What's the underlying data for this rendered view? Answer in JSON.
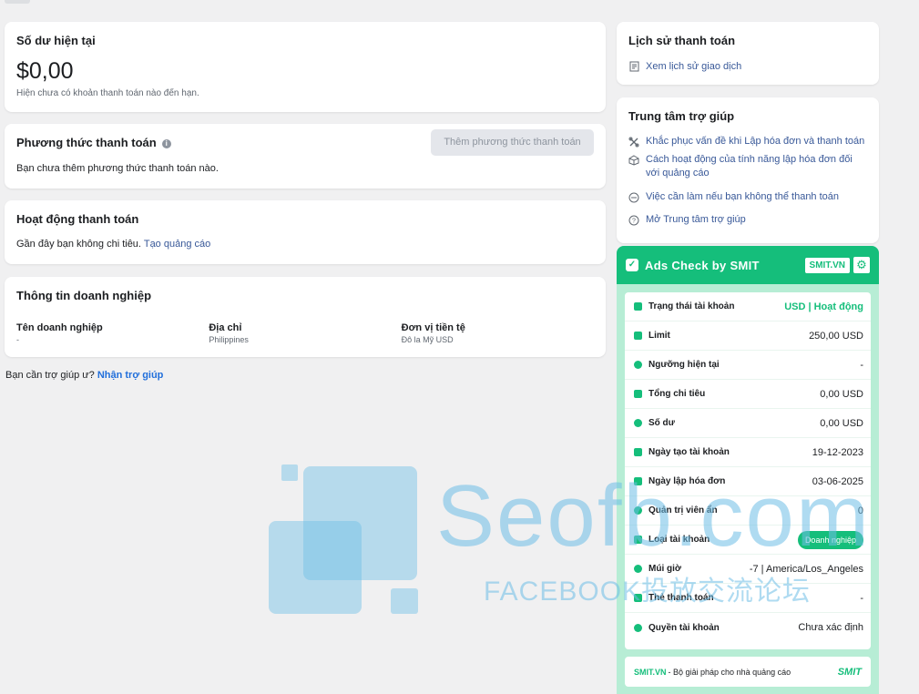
{
  "balance": {
    "title": "Số dư hiện tại",
    "amount": "$0,00",
    "sub": "Hiện chưa có khoản thanh toán nào đến hạn."
  },
  "payment_method": {
    "title": "Phương thức thanh toán",
    "add_label": "Thêm phương thức thanh toán",
    "desc": "Bạn chưa thêm phương thức thanh toán nào."
  },
  "activity": {
    "title": "Hoạt động thanh toán",
    "desc": "Gần đây bạn không chi tiêu.",
    "link": "Tạo quảng cáo"
  },
  "business": {
    "title": "Thông tin doanh nghiệp",
    "cols": [
      {
        "label": "Tên doanh nghiệp",
        "value": "-"
      },
      {
        "label": "Địa chỉ",
        "value": "Philippines"
      },
      {
        "label": "Đơn vị tiền tệ",
        "value": "Đô la Mỹ USD"
      }
    ]
  },
  "help_line": {
    "text": "Bạn cần trợ giúp ư?",
    "link": "Nhận trợ giúp"
  },
  "history": {
    "title": "Lịch sử thanh toán",
    "link": "Xem lịch sử giao dịch"
  },
  "help_center": {
    "title": "Trung tâm trợ giúp",
    "links": [
      "Khắc phục vấn đề khi Lập hóa đơn và thanh toán",
      "Cách hoạt động của tính năng lập hóa đơn đối với quảng cáo",
      "Việc cần làm nếu bạn không thể thanh toán",
      "Mở Trung tâm trợ giúp"
    ]
  },
  "ads_check": {
    "title": "Ads Check by SMIT",
    "badge": "SMIT.VN",
    "rows": [
      {
        "label": "Trạng thái tài khoản",
        "value": "USD | Hoạt động"
      },
      {
        "label": "Limit",
        "value": "250,00 USD"
      },
      {
        "label": "Ngưỡng hiện tại",
        "value": "-"
      },
      {
        "label": "Tổng chi tiêu",
        "value": "0,00 USD"
      },
      {
        "label": "Số dư",
        "value": "0,00 USD"
      },
      {
        "label": "Ngày tạo tài khoản",
        "value": "19-12-2023"
      },
      {
        "label": "Ngày lập hóa đơn",
        "value": "03-06-2025"
      },
      {
        "label": "Quản trị viên ẩn",
        "value": "0"
      },
      {
        "label": "Loại tài khoản",
        "value": "Doanh nghiệp"
      },
      {
        "label": "Múi giờ",
        "value": "-7 | America/Los_Angeles"
      },
      {
        "label": "Thẻ thanh toán",
        "value": "-"
      },
      {
        "label": "Quyền tài khoản",
        "value": "Chưa xác định"
      }
    ],
    "footer_brand": "SMIT.VN",
    "footer_text": "- Bộ giải pháp cho nhà quảng cáo",
    "footer_mark": "SMIT"
  },
  "watermark": {
    "big": "Seofb.com",
    "small": "FACEBOOK投放交流论坛"
  }
}
